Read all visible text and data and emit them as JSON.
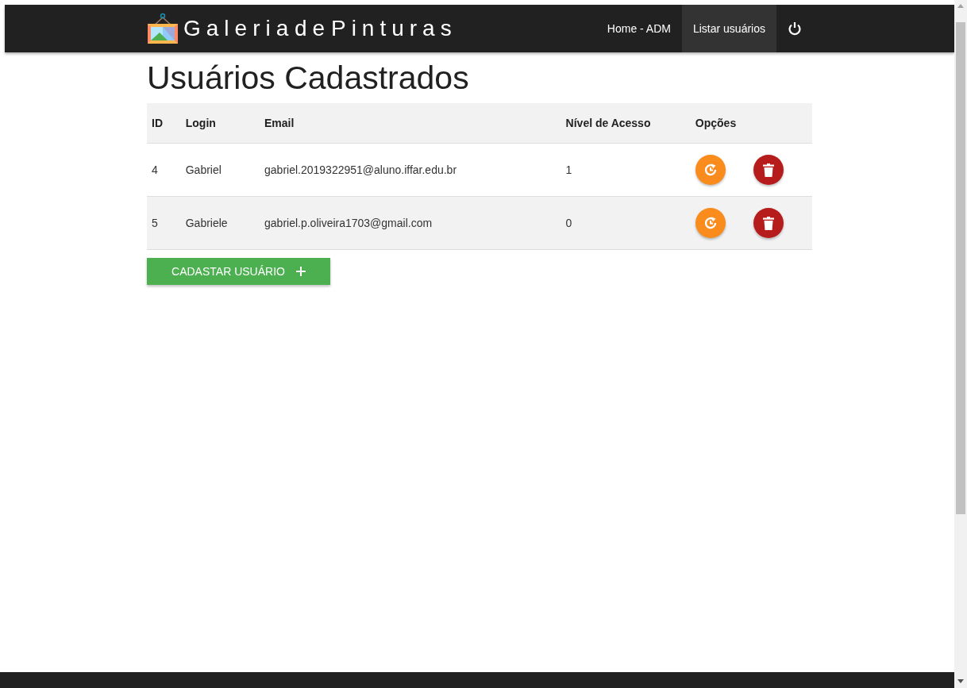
{
  "navbar": {
    "brand": "Galeria de Pinturas",
    "links": [
      {
        "label": "Home - ADM",
        "selected": false
      },
      {
        "label": "Listar usuários",
        "selected": true
      }
    ]
  },
  "page_title": "Usuários Cadastrados",
  "table": {
    "columns": [
      "ID",
      "Login",
      "Email",
      "Nível de Acesso",
      "Opções"
    ],
    "rows": [
      {
        "id": "4",
        "login": "Gabriel",
        "email": "gabriel.2019322951@aluno.iffar.edu.br",
        "access_level": "1"
      },
      {
        "id": "5",
        "login": "Gabriele",
        "email": "gabriel.p.oliveira1703@gmail.com",
        "access_level": "0"
      }
    ]
  },
  "add_button": {
    "label": "CADASTAR USUÁRIO"
  }
}
